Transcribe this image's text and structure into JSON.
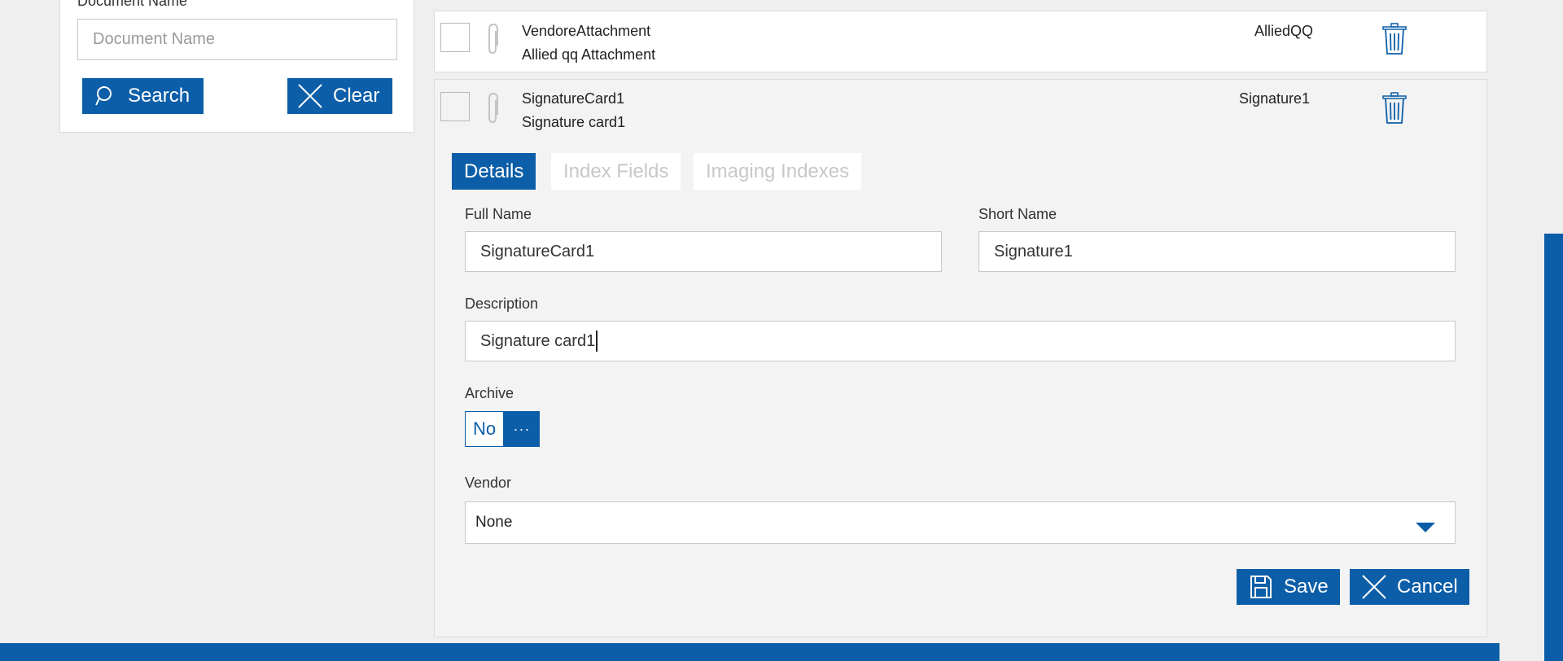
{
  "search_panel": {
    "document_name_label": "Document Name",
    "document_name_placeholder": "Document Name",
    "search_label": "Search",
    "clear_label": "Clear"
  },
  "documents": [
    {
      "title": "VendoreAttachment",
      "subtitle": "Allied qq Attachment",
      "short_name": "AlliedQQ"
    },
    {
      "title": "SignatureCard1",
      "subtitle": "Signature card1",
      "short_name": "Signature1"
    }
  ],
  "details": {
    "tabs": [
      "Details",
      "Index Fields",
      "Imaging Indexes"
    ],
    "active_tab": "Details",
    "full_name_label": "Full Name",
    "full_name_value": "SignatureCard1",
    "short_name_label": "Short Name",
    "short_name_value": "Signature1",
    "description_label": "Description",
    "description_value": "Signature card1",
    "archive_label": "Archive",
    "archive_value": "No",
    "archive_more": "···",
    "vendor_label": "Vendor",
    "vendor_value": "None",
    "save_label": "Save",
    "cancel_label": "Cancel"
  },
  "colors": {
    "accent": "#0c5ea8",
    "background": "#efefef",
    "inactive_tab_text": "#c8c8c8"
  },
  "icons": [
    "search-icon",
    "close-icon",
    "paperclip-icon",
    "trash-icon",
    "save-icon",
    "chevron-down-icon"
  ]
}
